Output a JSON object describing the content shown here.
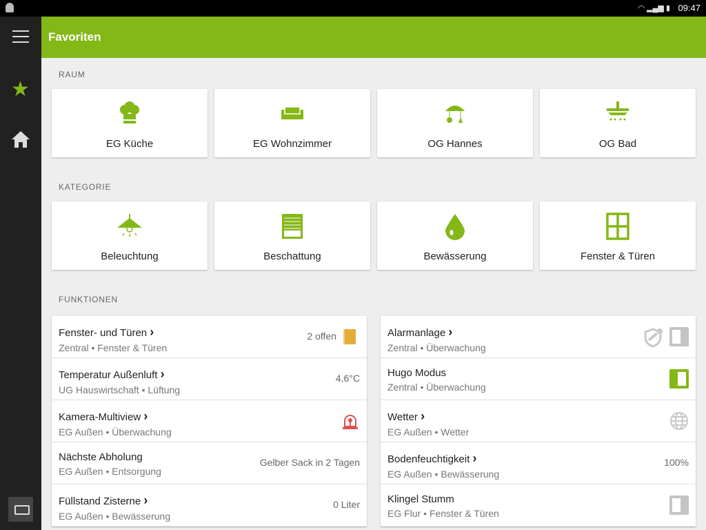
{
  "status": {
    "time": "09:47"
  },
  "header": {
    "title": "Favoriten"
  },
  "colors": {
    "accent": "#84b817",
    "sidebar": "#212121"
  },
  "sections": {
    "raum": "RAUM",
    "kategorie": "KATEGORIE",
    "funktionen": "FUNKTIONEN"
  },
  "rooms": [
    {
      "label": "EG Küche",
      "icon": "chef-hat-icon"
    },
    {
      "label": "EG Wohnzimmer",
      "icon": "sofa-icon"
    },
    {
      "label": "OG Hannes",
      "icon": "baby-mobile-icon"
    },
    {
      "label": "OG Bad",
      "icon": "shower-icon"
    }
  ],
  "categories": [
    {
      "label": "Beleuchtung",
      "icon": "lamp-icon"
    },
    {
      "label": "Beschattung",
      "icon": "shutter-icon"
    },
    {
      "label": "Bewässerung",
      "icon": "water-drop-icon"
    },
    {
      "label": "Fenster & Türen",
      "icon": "window-icon"
    }
  ],
  "left": [
    {
      "title": "Fenster- und Türen",
      "chev": "›",
      "sub": "Zentral • Fenster & Türen",
      "value": "2 offen"
    },
    {
      "title": "Temperatur Außenluft",
      "chev": "›",
      "sub": "UG Hauswirtschaft • Lüftung",
      "value": "4,6°C"
    },
    {
      "title": "Kamera-Multiview",
      "chev": "›",
      "sub": "EG Außen • Überwachung"
    },
    {
      "title": "Nächste Abholung",
      "sub": "EG Außen • Entsorgung",
      "value": "Gelber Sack in 2 Tagen"
    },
    {
      "title": "Füllstand Zisterne",
      "chev": "›",
      "sub": "EG Außen • Bewässerung",
      "value": "0 Liter"
    }
  ],
  "right": [
    {
      "title": "Alarmanlage",
      "chev": "›",
      "sub": "Zentral • Überwachung",
      "toggle": false
    },
    {
      "title": "Hugo Modus",
      "sub": "Zentral • Überwachung",
      "toggle": true
    },
    {
      "title": "Wetter",
      "chev": "›",
      "sub": "EG Außen • Wetter"
    },
    {
      "title": "Bodenfeuchtigkeit",
      "chev": "›",
      "sub": "EG Außen • Bewässerung",
      "value": "100%"
    },
    {
      "title": "Klingel Stumm",
      "sub": "EG Flur • Fenster & Türen",
      "toggle": false
    }
  ]
}
